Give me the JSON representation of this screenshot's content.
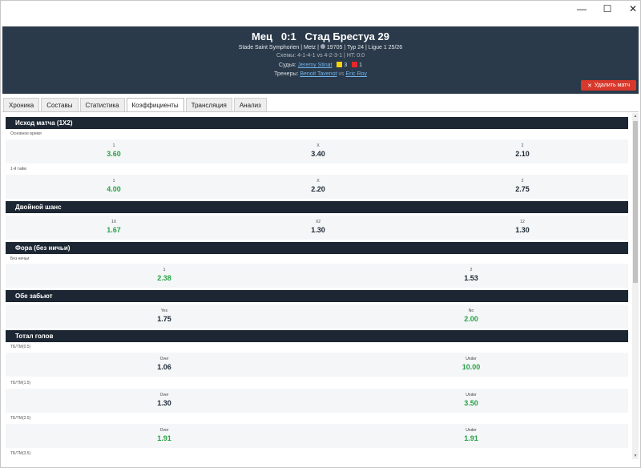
{
  "window": {
    "min_label": "—",
    "max_label": "☐",
    "close_label": "✕"
  },
  "header": {
    "score_line": "Мец   0:1   Стад Брестуа 29",
    "venue": "Stade Saint Symphorien",
    "city": "Metz",
    "attendance": "19705",
    "round": "Тур 24",
    "league": "Ligue 1 25/26",
    "schemes": "Схемы: 4-1-4-1 vs 4-2-3-1 | HT: 0:0",
    "referee_label": "Судья:",
    "referee_name": "Jeremy Stinat",
    "yellow_cards": "3",
    "red_cards": "1",
    "coaches_label": "Тренеры:",
    "coach_home": "Benoit Tavenot",
    "coaches_vs": "vs",
    "coach_away": "Eric Roy",
    "delete_button": "Удалить матч",
    "colors": {
      "background": "#2b3a4a",
      "delete": "#d9382c",
      "yellow_card": "#f4d40e",
      "red_card": "#e5262a"
    }
  },
  "tabs": [
    "Хроника",
    "Составы",
    "Статистика",
    "Коэффициенты",
    "Трансляция",
    "Анализ"
  ],
  "active_tab": "Коэффициенты",
  "sections": {
    "s1": {
      "title": "Исход матча (1X2)",
      "sub1": "Основное время",
      "sub2": "1-й тайм",
      "r1": [
        {
          "k": "1",
          "v": "3.60"
        },
        {
          "k": "X",
          "v": "3.40"
        },
        {
          "k": "2",
          "v": "2.10"
        }
      ],
      "r2": [
        {
          "k": "1",
          "v": "4.00"
        },
        {
          "k": "X",
          "v": "2.20"
        },
        {
          "k": "2",
          "v": "2.75"
        }
      ]
    },
    "s2": {
      "title": "Двойной шанс",
      "r1": [
        {
          "k": "1X",
          "v": "1.67"
        },
        {
          "k": "X2",
          "v": "1.30"
        },
        {
          "k": "12",
          "v": "1.30"
        }
      ]
    },
    "s3": {
      "title": "Фора (без ничьи)",
      "sub1": "Без ничьи",
      "r1": [
        {
          "k": "1",
          "v": "2.38"
        },
        {
          "k": "2",
          "v": "1.53"
        }
      ]
    },
    "s4": {
      "title": "Обе забьют",
      "r1": [
        {
          "k": "Yes",
          "v": "1.75"
        },
        {
          "k": "No",
          "v": "2.00"
        }
      ]
    },
    "s5": {
      "title": "Тотал голов",
      "sub1": "ТБ/ТМ(0.5)",
      "sub2": "ТБ/ТМ(1.5)",
      "sub3": "ТБ/ТМ(2.5)",
      "sub4": "ТБ/ТМ(3.5)",
      "r1": [
        {
          "k": "Over",
          "v": "1.06"
        },
        {
          "k": "Under",
          "v": "10.00"
        }
      ],
      "r2": [
        {
          "k": "Over",
          "v": "1.30"
        },
        {
          "k": "Under",
          "v": "3.50"
        }
      ],
      "r3": [
        {
          "k": "Over",
          "v": "1.91"
        },
        {
          "k": "Under",
          "v": "1.91"
        }
      ]
    }
  },
  "odds_colors": {
    "favorite": "#27a243",
    "other": "#1d2733"
  }
}
